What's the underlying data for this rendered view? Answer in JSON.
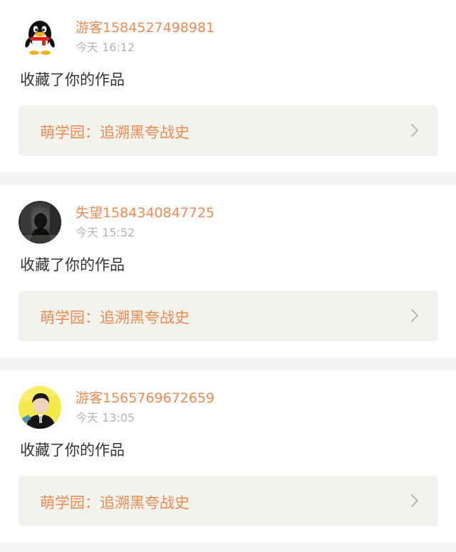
{
  "notifications": [
    {
      "avatar_icon": "qq-penguin-avatar",
      "username": "游客1584527498981",
      "time": "今天 16:12",
      "action": "收藏了你的作品",
      "work_title": "萌学园：追溯黑夸战史"
    },
    {
      "avatar_icon": "dark-photo-avatar",
      "username": "失望1584340847725",
      "time": "今天 15:52",
      "action": "收藏了你的作品",
      "work_title": "萌学园：追溯黑夸战史"
    },
    {
      "avatar_icon": "person-photo-avatar",
      "username": "游客1565769672659",
      "time": "今天 13:05",
      "action": "收藏了你的作品",
      "work_title": "萌学园：追溯黑夸战史"
    }
  ],
  "colors": {
    "accent": "#ee8a4f",
    "background": "#f4f4f4",
    "link_card": "#f3f3ee",
    "muted": "#b4b4b4"
  }
}
